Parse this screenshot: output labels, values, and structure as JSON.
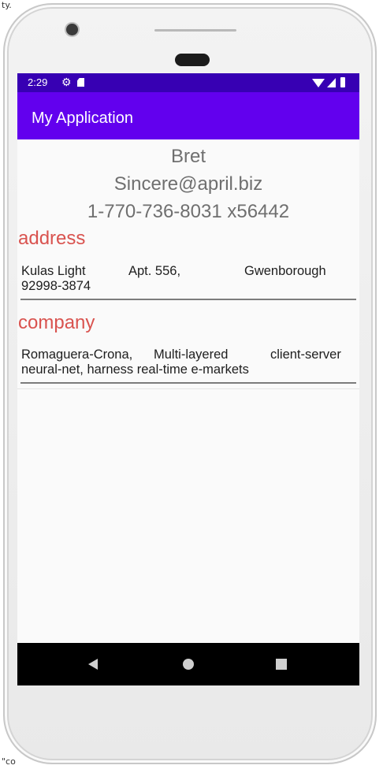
{
  "background": {
    "top_fragment": "ty.",
    "bottom_fragment": "\"co"
  },
  "status_bar": {
    "time": "2:29",
    "color": "#3700b3"
  },
  "app_bar": {
    "title": "My Application",
    "color": "#6200ee"
  },
  "user": {
    "username": "Bret",
    "email": "Sincere@april.biz",
    "phone": "1-770-736-8031 x56442"
  },
  "address": {
    "heading": "address",
    "street": "Kulas Light",
    "suite": "Apt. 556,",
    "city": "Gwenborough",
    "zipcode": "92998-3874"
  },
  "company": {
    "heading": "company",
    "name": "Romaguera-Crona,",
    "catch_phrase": "Multi-layered",
    "catch_phrase_2": "client-server",
    "line2": "neural-net, harness real-time e-markets"
  },
  "colors": {
    "section_heading": "#d9534f",
    "primary_text": "#6f6f6f"
  },
  "icons": [
    "gear-icon",
    "sdcard-icon",
    "wifi-icon",
    "signal-icon",
    "battery-icon",
    "back-icon",
    "home-icon",
    "recents-icon"
  ]
}
